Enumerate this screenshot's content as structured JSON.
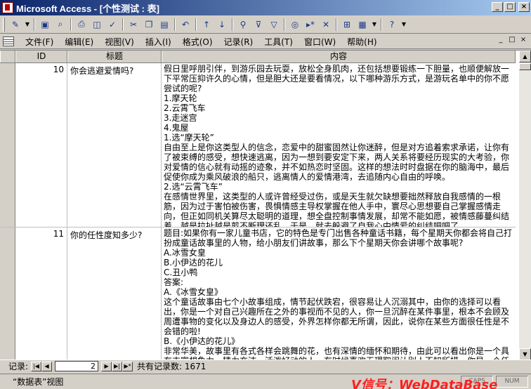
{
  "window": {
    "title": "Microsoft Access - [个性测试 : 表]",
    "buttons": [
      "_",
      "□",
      "×"
    ]
  },
  "menu": {
    "items": [
      "文件(F)",
      "编辑(E)",
      "视图(V)",
      "插入(I)",
      "格式(O)",
      "记录(R)",
      "工具(T)",
      "窗口(W)",
      "帮助(H)"
    ],
    "right_buttons": [
      "_",
      "□",
      "×"
    ]
  },
  "table": {
    "columns": [
      "ID",
      "标题",
      "内容"
    ],
    "rows": [
      {
        "id": "10",
        "title": "你会逃避爱情吗?",
        "content": [
          "假日里呼朋引伴，到游乐园去玩耍，放松全身肌肉，还包括想要锻练一下胆量，也顺便解放一下平常压抑许久的心情，但是胆大还是要看情况，以下哪种游乐方式，是游玩名单中的你不愿尝试的呢?",
          "1.摩天轮",
          "2.云霄飞车",
          "3.走迷宫",
          "4.鬼屋",
          "1.选“摩天轮”",
          "自由至上是你这类型人的信念，恋爱中的甜蜜固然让你迷醉，但是对方追着索求承诺，让你有了被束缚的感受，想快速逃离，因为一想到要安定下来，两人关系将要经历现实的大考验，你对爱情的信心就有动摇的迹象，并不如热恋时坚固。这样的想法时时盘据在你的脑海中，最后促使你成为乘风破浪的船只，逃离情人的爱情港湾，去追随内心自由的呼唤。",
          "2.选“云霄飞车”",
          "在感情世界里，这类型的人或许曾经受过伤，或是天生就欠缺想要拙然释放自我感情的一根筋，因为过于害怕被伤害，畏惧情感主导权掌握在他人手中，寰尽心思想要自己掌握感情走向，但正如同机关算尽太聪明的道理，想全盘控制事情发展，却常不能如愿，被情感藤蔓纠结着，越是拉扯越是剪不断理还乱，于是，就去躲避了自我心中情爱的纠结吧吧了"
        ]
      },
      {
        "id": "11",
        "title": "你的任性度知多少?",
        "content": [
          "题目:如果你有一家儿童书店，它的特色是专门出售各种童话书籍，每个星期天你都会将自己打扮成童话故事里的人物，给小朋友们讲故事，那么下个星期天你会讲哪个故事呢?",
          "A.冰雪女皇",
          "B.小伊达的花儿",
          "C.丑小鸭",
          "答案:",
          "A.《冰雪女皇》",
          "这个童话故事由七个小故事组成，情节起伏跌宕，很容易让人沉溺其中，由你的选择可以看出，你是一个对自己兴趣所在之外的事视而不见的人，你一旦沉醉在某件事里，根本不会顾及周遭事物的变化以及身边人的感受，外界怎样你都无所谓，因此，说你在某些方面很任性是不会错的啦!",
          "B.《小伊达的花儿》",
          "非常华美，故事里有各式各样会跳舞的花，也有深情的缅怀和期待，由此可以看出你是一个具有丰富想象力，精力充沛，活泼好动的人，有时候喜欢无理取闹让别人不知所措，你是一个任性的人"
        ]
      }
    ]
  },
  "navigation": {
    "label": "记录:",
    "current": "2",
    "total_text": "共有记录数: 1671",
    "buttons": [
      "|◀",
      "◀",
      "▶",
      "▶|",
      "▶*"
    ]
  },
  "status": {
    "view_text": "“数据表”视图",
    "indicators": [
      "CAPS",
      "NUM"
    ],
    "watermark": "V信号：WebDataBase"
  }
}
